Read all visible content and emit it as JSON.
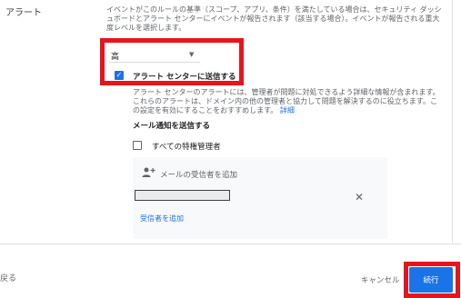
{
  "section_label": "アラート",
  "description": "イベントがこのルールの基準（スコープ、アプリ、条件）を満たしている場合は、セキュリティ ダッシュボードとアラート センターにイベントが報告されます（該当する場合）。イベントが報告される重大度レベルを選択します。",
  "severity_select": {
    "value": "高"
  },
  "alert_center_checkbox": {
    "label": "アラート センターに送信する",
    "checked": true
  },
  "alert_note": {
    "text": "アラート センターのアラートには、管理者が問題に対処できるよう詳細な情報が含まれます。これらのアラートは、ドメイン内の他の管理者と協力して問題を解決するのに役立ちます。この設定を有効にすることをおすすめします。",
    "link": "詳細"
  },
  "email_section": {
    "title": "メール通知を送信する"
  },
  "super_admins_checkbox": {
    "label": "すべての特権管理者",
    "checked": false
  },
  "recipients_panel": {
    "header": "メールの受信者を追加",
    "input_value": "",
    "add_link": "受信者を追加"
  },
  "footer": {
    "left_label": "戻る",
    "cancel": "キャンセル",
    "continue": "続行"
  },
  "colors": {
    "accent": "#1a73e8",
    "highlight": "#e8141b"
  },
  "icons": [
    "chevron-down-icon",
    "check-icon",
    "person-add-icon",
    "close-icon"
  ]
}
